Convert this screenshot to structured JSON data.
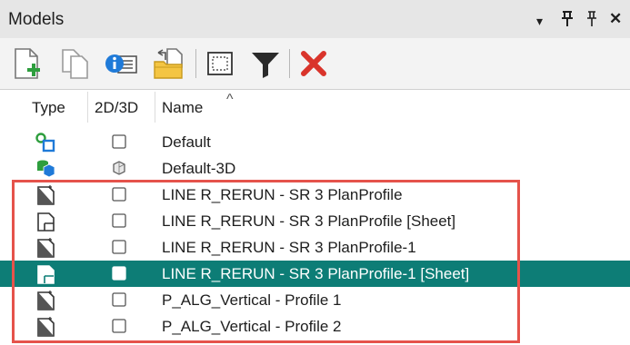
{
  "panel": {
    "title": "Models",
    "controls": {
      "dropdown": "▾",
      "pin": "⊓",
      "autohide": "ᵽ",
      "close": "✕"
    }
  },
  "toolbar": {
    "buttons": [
      {
        "icon": "new-model-icon"
      },
      {
        "icon": "copy-model-icon"
      },
      {
        "icon": "properties-icon"
      },
      {
        "icon": "attach-folder-icon"
      },
      {
        "icon": "select-all-icon"
      },
      {
        "icon": "filter-icon"
      },
      {
        "icon": "delete-icon"
      }
    ]
  },
  "columns": {
    "type": "Type",
    "dim": "2D/3D",
    "name": "Name",
    "sort": "^"
  },
  "rows": [
    {
      "name": "Default",
      "type_icon": "design-model-2d-icon",
      "dim_icon": "2d-checkbox-icon",
      "selected": false
    },
    {
      "name": "Default-3D",
      "type_icon": "design-model-3d-icon",
      "dim_icon": "3d-cube-icon",
      "selected": false
    },
    {
      "name": "LINE R_RERUN - SR 3 PlanProfile",
      "type_icon": "drawing-model-icon",
      "dim_icon": "2d-checkbox-icon",
      "selected": false
    },
    {
      "name": "LINE R_RERUN - SR 3 PlanProfile [Sheet]",
      "type_icon": "sheet-model-icon",
      "dim_icon": "2d-checkbox-icon",
      "selected": false
    },
    {
      "name": "LINE R_RERUN - SR 3 PlanProfile-1",
      "type_icon": "drawing-model-icon",
      "dim_icon": "2d-checkbox-icon",
      "selected": false
    },
    {
      "name": "LINE R_RERUN - SR 3 PlanProfile-1 [Sheet]",
      "type_icon": "sheet-model-icon",
      "dim_icon": "2d-checkbox-icon",
      "selected": true
    },
    {
      "name": "P_ALG_Vertical - Profile 1",
      "type_icon": "drawing-model-icon",
      "dim_icon": "2d-checkbox-icon",
      "selected": false
    },
    {
      "name": "P_ALG_Vertical - Profile 2",
      "type_icon": "drawing-model-icon",
      "dim_icon": "2d-checkbox-icon",
      "selected": false
    }
  ],
  "colors": {
    "selection": "#0d7d76",
    "highlight_box": "#e5534b",
    "delete": "#d9342b",
    "info_blue": "#1f7ad8",
    "green": "#2e9e3e"
  }
}
